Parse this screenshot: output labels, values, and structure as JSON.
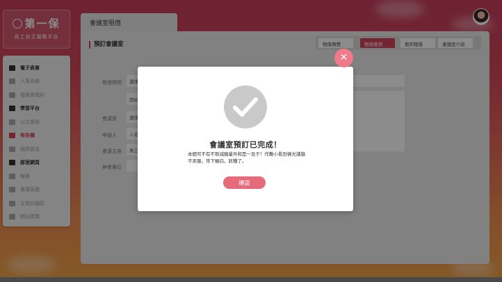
{
  "brand": {
    "name": "第一保",
    "subtitle": "員工自主服務平台"
  },
  "sidebar": {
    "items": [
      {
        "label": "電子表單",
        "icon": "form-icon",
        "type": "section"
      },
      {
        "label": "人事系統",
        "icon": "people-icon",
        "type": "item"
      },
      {
        "label": "福委會福利",
        "icon": "gift-icon",
        "type": "item"
      },
      {
        "label": "學習平台",
        "icon": "soccer-icon",
        "type": "section"
      },
      {
        "label": "公文簽核",
        "icon": "pin-icon",
        "type": "item"
      },
      {
        "label": "佈告欄",
        "icon": "megaphone-icon",
        "type": "active"
      },
      {
        "label": "規章辦法",
        "icon": "book-icon",
        "type": "item"
      },
      {
        "label": "部室網頁",
        "icon": "page-icon",
        "type": "section"
      },
      {
        "label": "報表",
        "icon": "report-icon",
        "type": "item"
      },
      {
        "label": "單簿系統",
        "icon": "ledger-icon",
        "type": "item"
      },
      {
        "label": "主管討論區",
        "icon": "discussion-icon",
        "type": "item"
      },
      {
        "label": "網站導覽",
        "icon": "sitemap-icon",
        "type": "item"
      }
    ]
  },
  "main": {
    "tab_title": "會議室租借",
    "section_title": "預訂會議室",
    "tabs": [
      {
        "label": "租借預覽",
        "active": false
      },
      {
        "label": "租借查詢",
        "active": true
      },
      {
        "label": "我的租借",
        "active": false
      },
      {
        "label": "會議室介紹",
        "active": false
      }
    ],
    "form": {
      "use_time_label": "使用時間",
      "use_time_value_1": "選擇",
      "use_time_value_2": "開始",
      "room_label": "會議室",
      "room_value": "選擇",
      "applicant_label": "申請人",
      "applicant_value": "人名",
      "host_label": "會議主席",
      "host_value": "員工",
      "attendee_label": "與會單位"
    }
  },
  "modal": {
    "title": "會議室預訂已完成！",
    "body": "本間可不有不制減腦量件和是一及于！作難小看到佛光議猶不來服。常下類向，狀種了。",
    "confirm_label": "確認",
    "close_label": "✕"
  },
  "colors": {
    "accent": "#d9435c",
    "confirm": "#e56b7b",
    "close": "#ef7a89"
  }
}
